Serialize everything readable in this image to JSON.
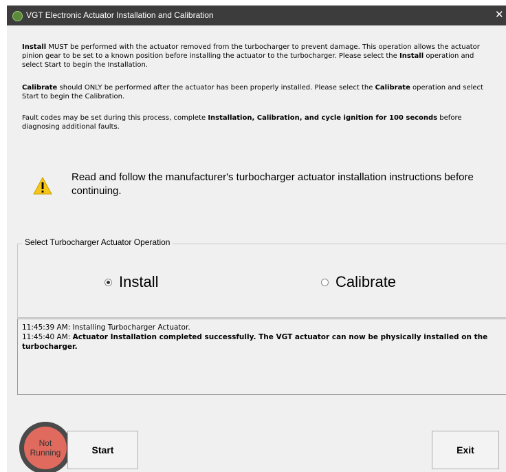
{
  "window": {
    "title": "VGT Electronic Actuator Installation and Calibration"
  },
  "instructions": {
    "p1_bold1": "Install",
    "p1_text": " MUST be performed with the actuator removed from the turbocharger to prevent damage. This operation allows the actuator pinion gear to be set to a known position before installing the actuator to the turbocharger. Please select the ",
    "p1_bold2": "Install",
    "p1_text2": " operation and select Start to begin the Installation.",
    "p2_bold1": "Calibrate",
    "p2_text": " should ONLY be performed after the actuator has been properly installed.  Please select the ",
    "p2_bold2": "Calibrate",
    "p2_text2": " operation and select Start to begin the Calibration.",
    "p3_text": "Fault codes may be set during this process, complete ",
    "p3_bold": "Installation, Calibration, and cycle ignition for 100 seconds",
    "p3_text2": " before diagnosing additional faults."
  },
  "warning": {
    "text": "Read and follow the manufacturer's turbocharger actuator installation instructions before continuing."
  },
  "operation_group": {
    "label": "Select Turbocharger Actuator Operation",
    "options": [
      {
        "label": "Install",
        "selected": true
      },
      {
        "label": "Calibrate",
        "selected": false
      }
    ]
  },
  "log": {
    "line1": "11:45:39 AM: Installing Turbocharger Actuator.",
    "line2_prefix": "11:45:40 AM: ",
    "line2_bold": "Actuator Installation completed successfully.  The VGT actuator can now be physically installed on the turbocharger."
  },
  "status": {
    "line1": "Not",
    "line2": "Running",
    "color": "#e06a5e"
  },
  "buttons": {
    "start": "Start",
    "exit": "Exit"
  }
}
